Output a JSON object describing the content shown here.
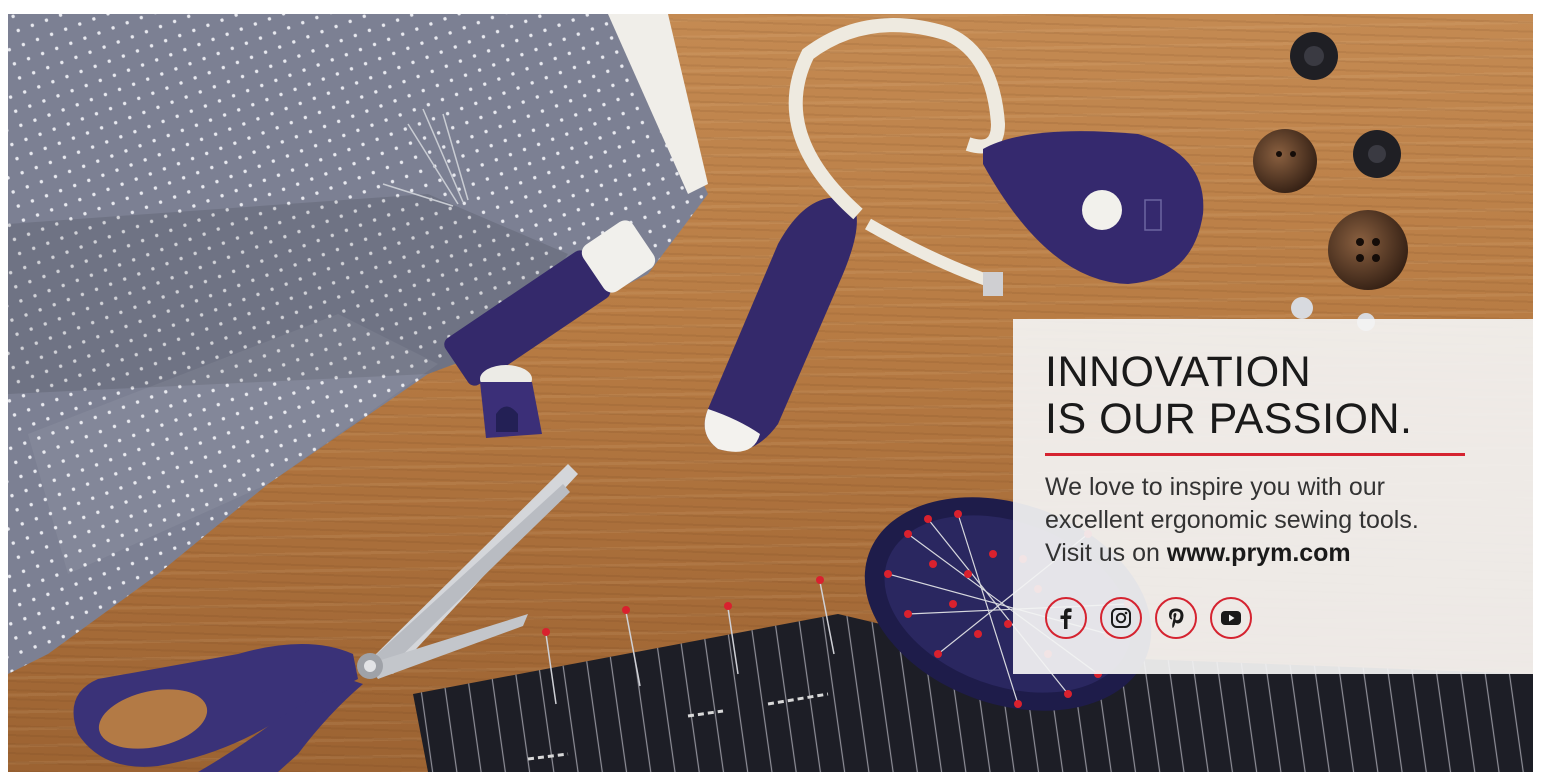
{
  "headline": {
    "line1": "INNOVATION",
    "line2": "IS OUR PASSION."
  },
  "body": {
    "line1": "We love to inspire you with our",
    "line2": "excellent ergonomic sewing tools.",
    "line3_prefix": "Visit us on ",
    "website": "www.prym.com"
  },
  "social": [
    {
      "name": "facebook",
      "icon": "facebook-icon"
    },
    {
      "name": "instagram",
      "icon": "instagram-icon"
    },
    {
      "name": "pinterest",
      "icon": "pinterest-icon"
    },
    {
      "name": "youtube",
      "icon": "youtube-icon"
    }
  ],
  "colors": {
    "accent_red": "#d52330",
    "brand_purple": "#3a2f72",
    "panel": "#f3f3f3",
    "wood": "#b87c44",
    "fabric": "#7b7f92"
  }
}
